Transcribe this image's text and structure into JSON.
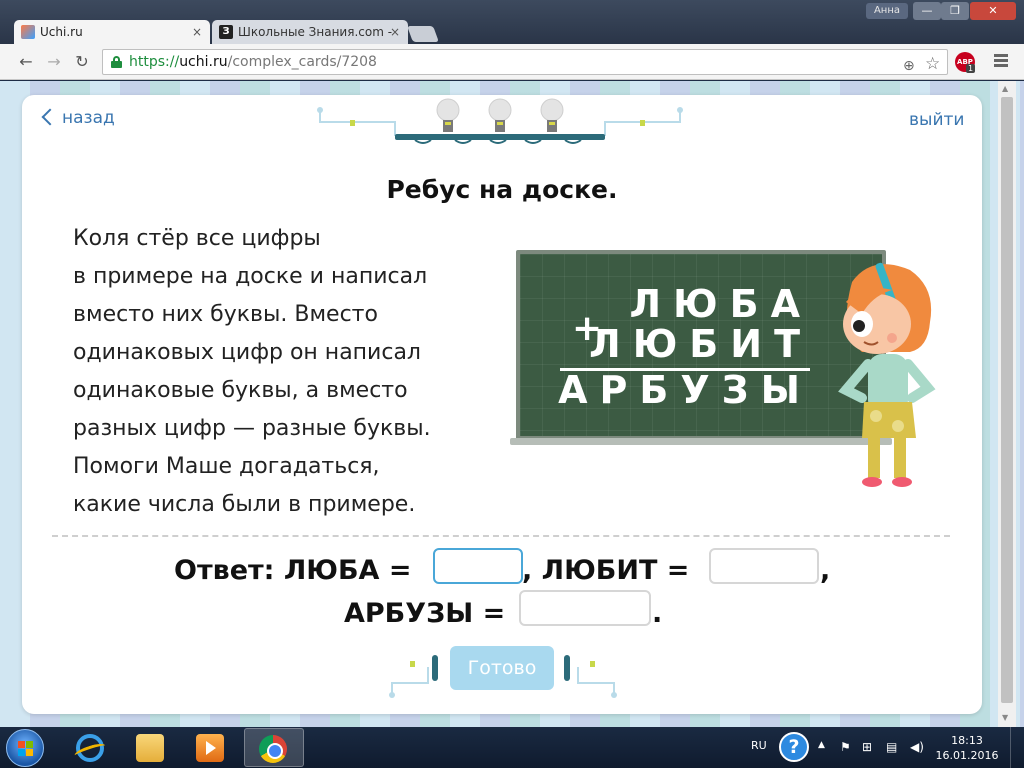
{
  "window": {
    "user_label": "Анна",
    "min_glyph": "—",
    "max_glyph": "❐",
    "close_glyph": "✕"
  },
  "tabs": [
    {
      "label": "Uchi.ru",
      "close": "×"
    },
    {
      "label": "Школьные Знания.com -",
      "close": "×",
      "favicon_letter": "З"
    }
  ],
  "toolbar": {
    "back_glyph": "←",
    "forward_glyph": "→",
    "reload_glyph": "↻",
    "url_scheme": "https://",
    "url_host": "uchi.ru",
    "url_path": "/complex_cards/7208",
    "zoom_glyph": "⊕",
    "star_glyph": "☆",
    "abp_label": "ABP",
    "abp_count": "1"
  },
  "page": {
    "back_label": "назад",
    "exit_label": "выйти",
    "title": "Ребус на доске.",
    "task_lines": [
      "Коля стёр все цифры",
      "в примере на доске и написал",
      "вместо них буквы. Вместо",
      "одинаковых цифр он написал",
      "одинаковые буквы, а вместо",
      "разных цифр — разные буквы.",
      "Помоги Маше догадаться,",
      "какие числа были в примере."
    ],
    "board": {
      "addend1": "ЛЮБА",
      "addend2": "ЛЮБИТ",
      "sum": "АРБУЗЫ",
      "operator": "+"
    },
    "answer": {
      "prefix": "Ответ: ЛЮБА =",
      "mid1": ", ЛЮБИТ =",
      "end1": ",",
      "prefix2": "АРБУЗЫ =",
      "end2": "."
    },
    "ready_label": "Готово"
  },
  "taskbar": {
    "lang": "RU",
    "help_glyph": "?",
    "time": "18:13",
    "date": "16.01.2016"
  },
  "colors": {
    "link": "#3a76b0",
    "board": "#3c5b43",
    "ready_button": "#a9d9ef",
    "input_focus": "#4aa7d8"
  }
}
